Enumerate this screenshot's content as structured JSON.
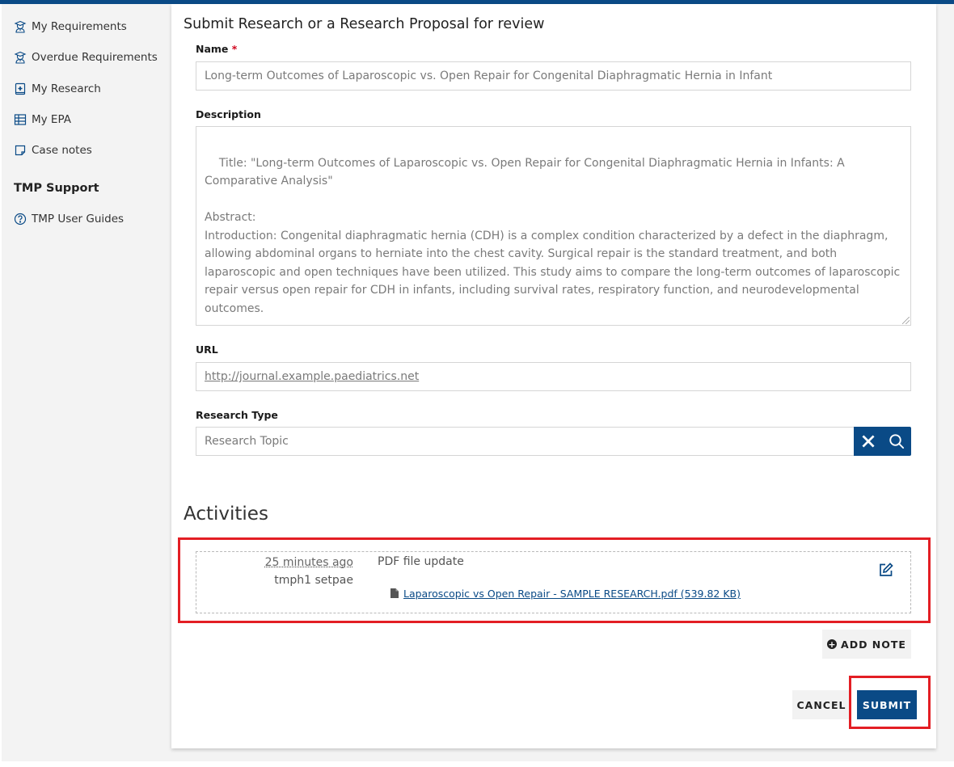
{
  "colors": {
    "brand": "#0a4a86",
    "highlight": "#e31e24",
    "required": "#d0021b"
  },
  "sidebar": {
    "items": [
      {
        "label": "My Requirements",
        "icon": "graduate-icon"
      },
      {
        "label": "Overdue Requirements",
        "icon": "graduate-icon"
      },
      {
        "label": "My Research",
        "icon": "book-plus-icon"
      },
      {
        "label": "My EPA",
        "icon": "table-icon"
      },
      {
        "label": "Case notes",
        "icon": "note-icon"
      }
    ],
    "support_heading": "TMP Support",
    "support_items": [
      {
        "label": "TMP User Guides",
        "icon": "question-circle-icon"
      }
    ]
  },
  "form": {
    "title": "Submit Research or a Research Proposal for review",
    "name": {
      "label": "Name",
      "required_mark": "*",
      "value": "Long-term Outcomes of Laparoscopic vs. Open Repair for Congenital Diaphragmatic Hernia in Infant"
    },
    "description": {
      "label": "Description",
      "value": "Title: \"Long-term Outcomes of Laparoscopic vs. Open Repair for Congenital Diaphragmatic Hernia in Infants: A Comparative Analysis\"\n\nAbstract:\nIntroduction: Congenital diaphragmatic hernia (CDH) is a complex condition characterized by a defect in the diaphragm, allowing abdominal organs to herniate into the chest cavity. Surgical repair is the standard treatment, and both laparoscopic and open techniques have been utilized. This study aims to compare the long-term outcomes of laparoscopic repair versus open repair for CDH in infants, including survival rates, respiratory function, and neurodevelopmental outcomes."
    },
    "url": {
      "label": "URL",
      "value": "http://journal.example.paediatrics.net"
    },
    "research_type": {
      "label": "Research Type",
      "value": "Research Topic",
      "clear_icon": "close-icon",
      "search_icon": "search-icon"
    }
  },
  "activities": {
    "title": "Activities",
    "items": [
      {
        "time": "25 minutes ago",
        "user": "tmph1 setpae",
        "title": "PDF file update",
        "file_label": "Laparoscopic vs Open Repair - SAMPLE RESEARCH.pdf (539.82 KB)",
        "file_icon": "file-icon",
        "edit_icon": "edit-icon"
      }
    ],
    "add_note_label": "ADD NOTE"
  },
  "actions": {
    "cancel_label": "CANCEL",
    "submit_label": "SUBMIT"
  }
}
